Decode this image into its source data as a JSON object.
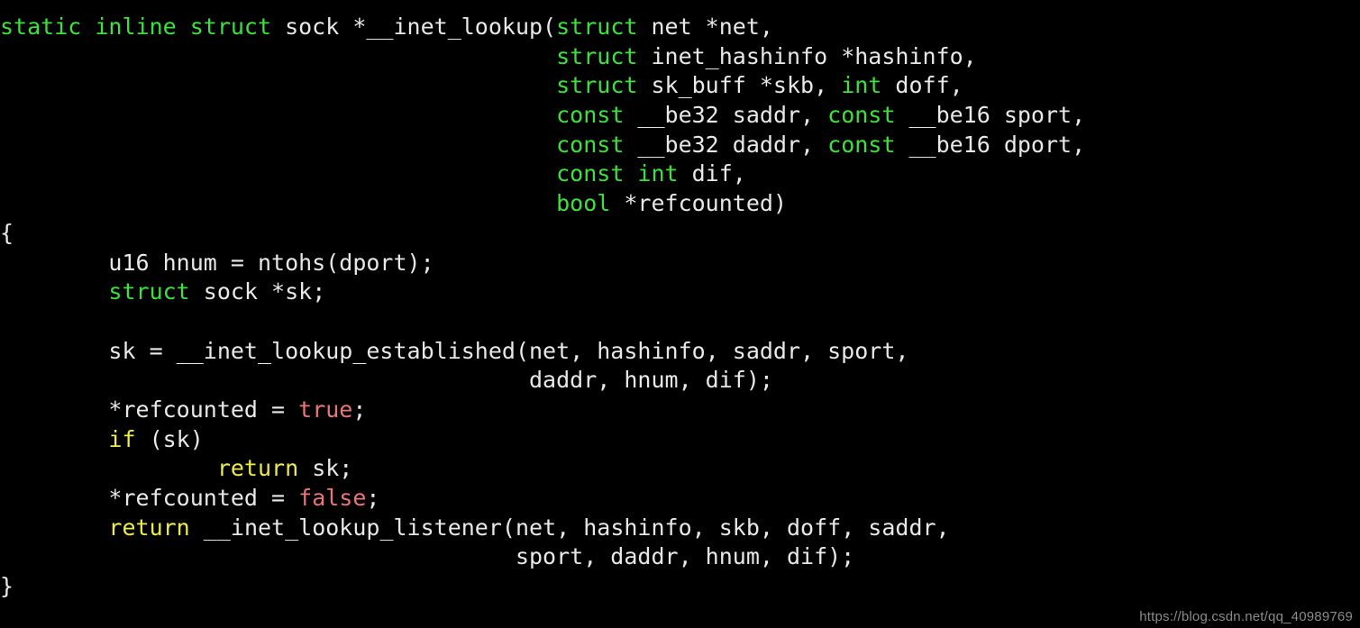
{
  "page": {
    "kind": "code-screenshot",
    "language": "C",
    "background_color": "#000000",
    "default_text_color": "#e8e8e8"
  },
  "theme": {
    "keyword_color": "#3ee03e",
    "control_color": "#ecec4e",
    "constant_color": "#e8767b",
    "plain_color": "#e8e8e8"
  },
  "watermark": {
    "text": "https://blog.csdn.net/qq_40989769"
  },
  "code": {
    "lines": [
      [
        {
          "t": "static inline struct",
          "c": "kw"
        },
        {
          "t": " sock *__inet_lookup(",
          "c": "plain"
        },
        {
          "t": "struct",
          "c": "kw"
        },
        {
          "t": " net *net,",
          "c": "plain"
        }
      ],
      [
        {
          "t": "                                         ",
          "c": "plain"
        },
        {
          "t": "struct",
          "c": "kw"
        },
        {
          "t": " inet_hashinfo *hashinfo,",
          "c": "plain"
        }
      ],
      [
        {
          "t": "                                         ",
          "c": "plain"
        },
        {
          "t": "struct",
          "c": "kw"
        },
        {
          "t": " sk_buff *skb, ",
          "c": "plain"
        },
        {
          "t": "int",
          "c": "kw"
        },
        {
          "t": " doff,",
          "c": "plain"
        }
      ],
      [
        {
          "t": "                                         ",
          "c": "plain"
        },
        {
          "t": "const",
          "c": "kw"
        },
        {
          "t": " __be32 saddr, ",
          "c": "plain"
        },
        {
          "t": "const",
          "c": "kw"
        },
        {
          "t": " __be16 sport,",
          "c": "plain"
        }
      ],
      [
        {
          "t": "                                         ",
          "c": "plain"
        },
        {
          "t": "const",
          "c": "kw"
        },
        {
          "t": " __be32 daddr, ",
          "c": "plain"
        },
        {
          "t": "const",
          "c": "kw"
        },
        {
          "t": " __be16 dport,",
          "c": "plain"
        }
      ],
      [
        {
          "t": "                                         ",
          "c": "plain"
        },
        {
          "t": "const int",
          "c": "kw"
        },
        {
          "t": " dif,",
          "c": "plain"
        }
      ],
      [
        {
          "t": "                                         ",
          "c": "plain"
        },
        {
          "t": "bool",
          "c": "kw"
        },
        {
          "t": " *refcounted)",
          "c": "plain"
        }
      ],
      [
        {
          "t": "{",
          "c": "plain"
        }
      ],
      [
        {
          "t": "        u16 hnum = ntohs(dport);",
          "c": "plain"
        }
      ],
      [
        {
          "t": "        ",
          "c": "plain"
        },
        {
          "t": "struct",
          "c": "kw"
        },
        {
          "t": " sock *sk;",
          "c": "plain"
        }
      ],
      [
        {
          "t": "",
          "c": "plain"
        }
      ],
      [
        {
          "t": "        sk = __inet_lookup_established(net, hashinfo, saddr, sport,",
          "c": "plain"
        }
      ],
      [
        {
          "t": "                                       daddr, hnum, dif);",
          "c": "plain"
        }
      ],
      [
        {
          "t": "        *refcounted = ",
          "c": "plain"
        },
        {
          "t": "true",
          "c": "const"
        },
        {
          "t": ";",
          "c": "plain"
        }
      ],
      [
        {
          "t": "        ",
          "c": "plain"
        },
        {
          "t": "if",
          "c": "ctrl"
        },
        {
          "t": " (sk)",
          "c": "plain"
        }
      ],
      [
        {
          "t": "                ",
          "c": "plain"
        },
        {
          "t": "return",
          "c": "ctrl"
        },
        {
          "t": " sk;",
          "c": "plain"
        }
      ],
      [
        {
          "t": "        *refcounted = ",
          "c": "plain"
        },
        {
          "t": "false",
          "c": "const"
        },
        {
          "t": ";",
          "c": "plain"
        }
      ],
      [
        {
          "t": "        ",
          "c": "plain"
        },
        {
          "t": "return",
          "c": "ctrl"
        },
        {
          "t": " __inet_lookup_listener(net, hashinfo, skb, doff, saddr,",
          "c": "plain"
        }
      ],
      [
        {
          "t": "                                      sport, daddr, hnum, dif);",
          "c": "plain"
        }
      ],
      [
        {
          "t": "}",
          "c": "plain"
        }
      ]
    ]
  }
}
